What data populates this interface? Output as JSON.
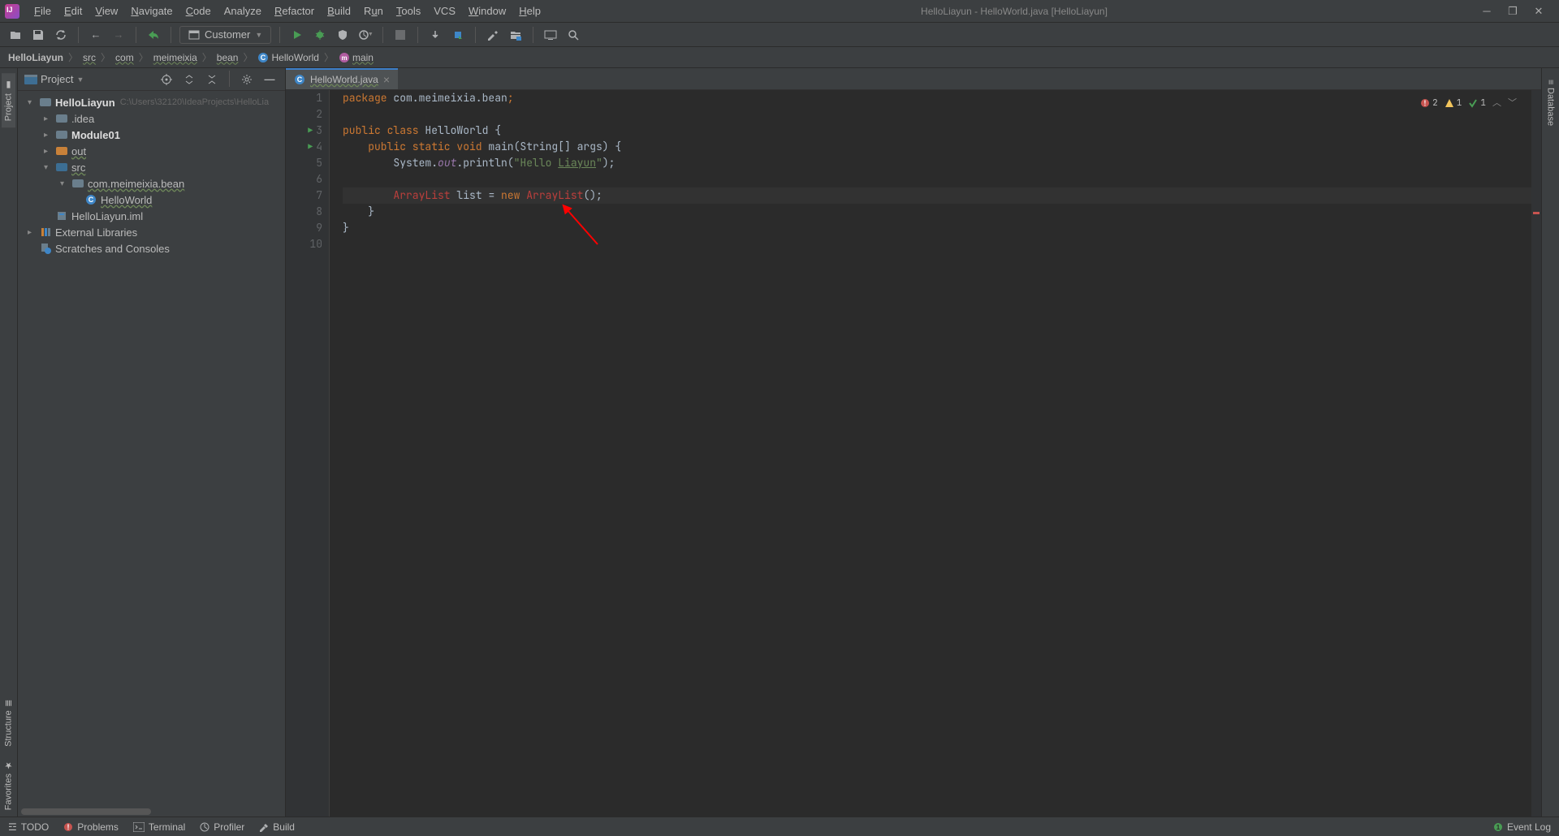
{
  "window_title": "HelloLiayun - HelloWorld.java [HelloLiayun]",
  "menu": {
    "file": "File",
    "edit": "Edit",
    "view": "View",
    "navigate": "Navigate",
    "code": "Code",
    "analyze": "Analyze",
    "refactor": "Refactor",
    "build": "Build",
    "run": "Run",
    "tools": "Tools",
    "vcs": "VCS",
    "window": "Window",
    "help": "Help"
  },
  "run_config": "Customer",
  "breadcrumb": {
    "project": "HelloLiayun",
    "src": "src",
    "com": "com",
    "meimeixia": "meimeixia",
    "bean": "bean",
    "class": "HelloWorld",
    "method": "main"
  },
  "project_panel": {
    "title": "Project"
  },
  "tree": {
    "root": {
      "name": "HelloLiayun",
      "path": "C:\\Users\\32120\\IdeaProjects\\HelloLia"
    },
    "idea": ".idea",
    "module01": "Module01",
    "out": "out",
    "src": "src",
    "package": "com.meimeixia.bean",
    "class": "HelloWorld",
    "iml": "HelloLiayun.iml",
    "ext": "External Libraries",
    "scratch": "Scratches and Consoles"
  },
  "tab": {
    "name": "HelloWorld.java"
  },
  "inspections": {
    "errors": "2",
    "warnings": "1",
    "weak": "1"
  },
  "code": {
    "l1_pkg": "package ",
    "l1_name": "com.meimeixia.bean",
    "l1_semi": ";",
    "l3": "public class ",
    "l3_name": "HelloWorld ",
    "l3_brace": "{",
    "l4": "    public static void ",
    "l4_main": "main",
    "l4_args": "(String[] args) {",
    "l5": "        System.",
    "l5_out": "out",
    "l5_println": ".println(",
    "l5_str1": "\"Hello ",
    "l5_str2": "Liayun",
    "l5_str3": "\"",
    "l5_end": ");",
    "l7_indent": "        ",
    "l7_al1": "ArrayList ",
    "l7_list": "list ",
    "l7_eq": "= ",
    "l7_new": "new ",
    "l7_al2": "ArrayList",
    "l7_end": "();",
    "l8": "    }",
    "l9": "}"
  },
  "lines": [
    "1",
    "2",
    "3",
    "4",
    "5",
    "6",
    "7",
    "8",
    "9",
    "10"
  ],
  "leftstripe": {
    "project": "Project",
    "structure": "Structure",
    "favorites": "Favorites"
  },
  "rightstripe": {
    "database": "Database"
  },
  "statusbar": {
    "todo": "TODO",
    "problems": "Problems",
    "terminal": "Terminal",
    "profiler": "Profiler",
    "build": "Build",
    "eventlog": "Event Log"
  }
}
